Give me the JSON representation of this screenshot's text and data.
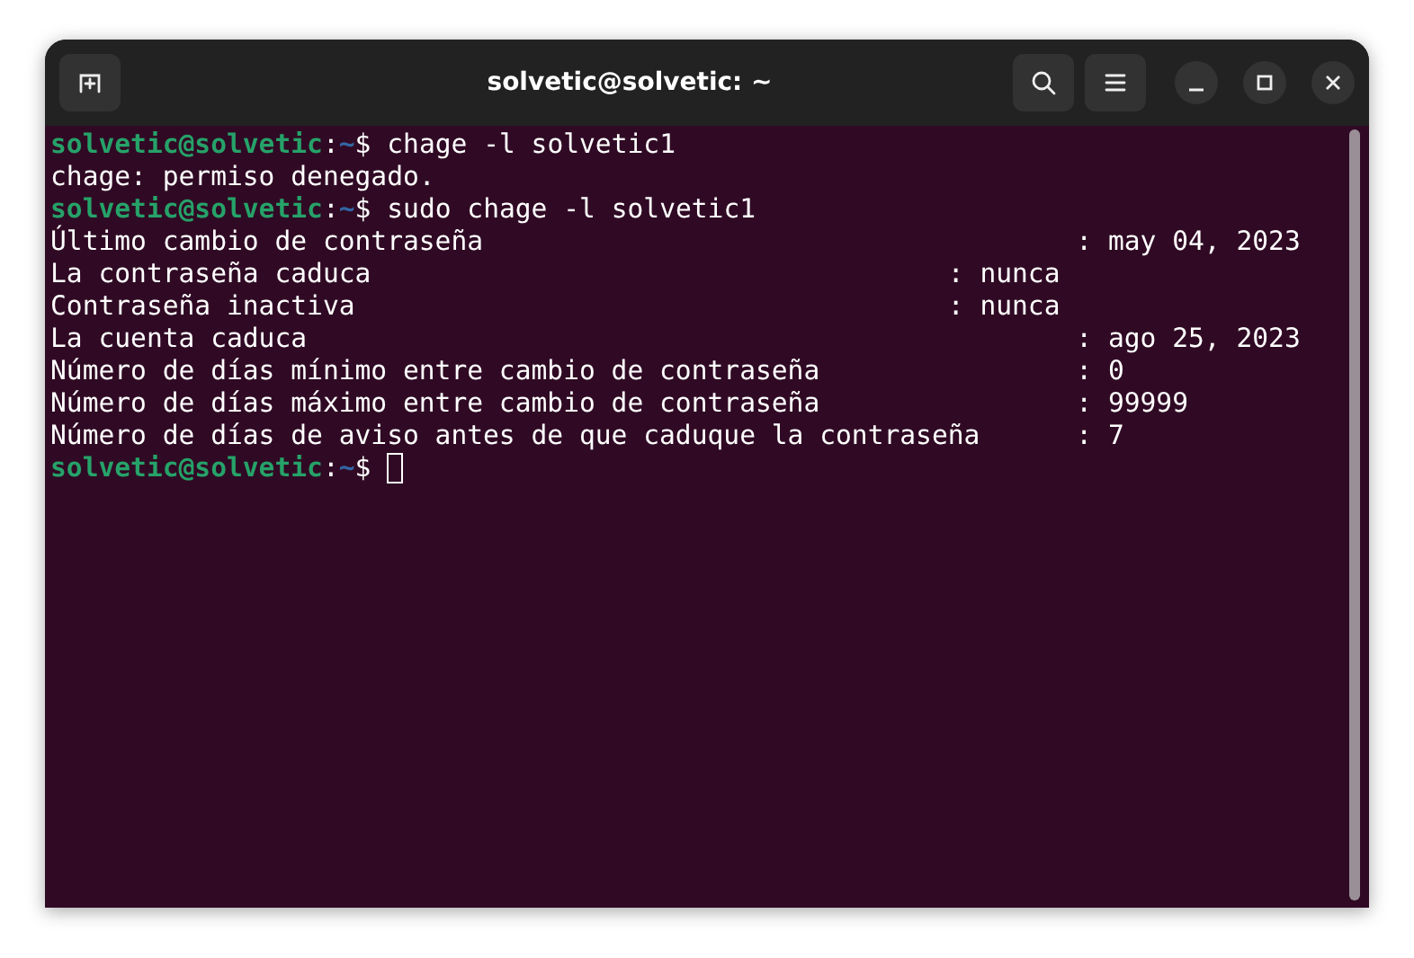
{
  "window": {
    "title": "solvetic@solvetic: ~"
  },
  "terminal": {
    "lines": [
      {
        "kind": "prompt",
        "user": "solvetic@solvetic",
        "separator": ":",
        "path": "~",
        "symbol": "$ ",
        "command": "chage -l solvetic1",
        "cursor": false
      },
      {
        "kind": "output",
        "text": "chage: permiso denegado."
      },
      {
        "kind": "prompt",
        "user": "solvetic@solvetic",
        "separator": ":",
        "path": "~",
        "symbol": "$ ",
        "command": "sudo chage -l solvetic1",
        "cursor": false
      },
      {
        "kind": "output",
        "text": "Último cambio de contraseña                                     : may 04, 2023"
      },
      {
        "kind": "output",
        "text": "La contraseña caduca                                    : nunca"
      },
      {
        "kind": "output",
        "text": "Contraseña inactiva                                     : nunca"
      },
      {
        "kind": "output",
        "text": "La cuenta caduca                                                : ago 25, 2023"
      },
      {
        "kind": "output",
        "text": "Número de días mínimo entre cambio de contraseña                : 0"
      },
      {
        "kind": "output",
        "text": "Número de días máximo entre cambio de contraseña                : 99999"
      },
      {
        "kind": "output",
        "text": "Número de días de aviso antes de que caduque la contraseña      : 7"
      },
      {
        "kind": "prompt",
        "user": "solvetic@solvetic",
        "separator": ":",
        "path": "~",
        "symbol": "$ ",
        "cursor": true
      }
    ]
  }
}
